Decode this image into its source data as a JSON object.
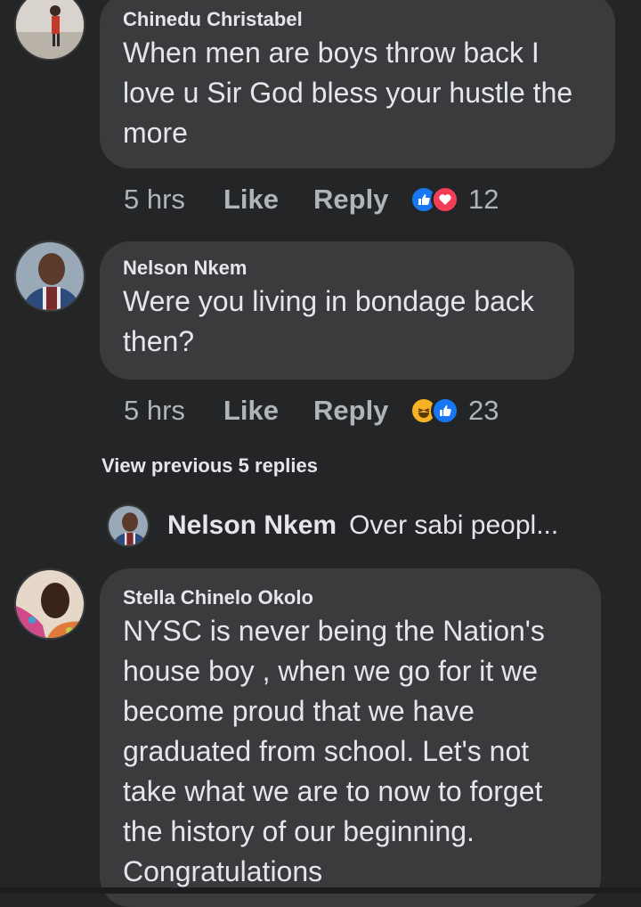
{
  "comments": [
    {
      "author": "Chinedu Christabel",
      "lines": [
        "When men are boys throw back I",
        "love u Sir God bless your hustle the",
        "more"
      ],
      "time": "5 hrs",
      "like_label": "Like",
      "reply_label": "Reply",
      "reactions": [
        "like-icon",
        "love-icon"
      ],
      "reaction_count": "12"
    },
    {
      "author": "Nelson Nkem",
      "lines": [
        "Were you living in bondage back",
        "then?"
      ],
      "time": "5 hrs",
      "like_label": "Like",
      "reply_label": "Reply",
      "reactions": [
        "haha-icon",
        "like-icon"
      ],
      "reaction_count": "23"
    },
    {
      "author": "Stella Chinelo Okolo",
      "lines": [
        "NYSC is never being the Nation's",
        "house boy , when we go for it we",
        "become proud that we have",
        "graduated from school. Let's not",
        "take what we  are to now to forget",
        "the history of our beginning.",
        "Congratulations"
      ]
    }
  ],
  "view_previous": "View previous 5 replies",
  "mini_reply": {
    "author": "Nelson Nkem",
    "snippet": "Over sabi peopl..."
  },
  "colors": {
    "background": "#242526",
    "bubble": "#3a3b3c",
    "primary_text": "#e4e6eb",
    "secondary_text": "#b0b3b8",
    "like_blue": "#1877f2",
    "love_red": "#f33e58",
    "haha_yellow": "#f7b125"
  }
}
